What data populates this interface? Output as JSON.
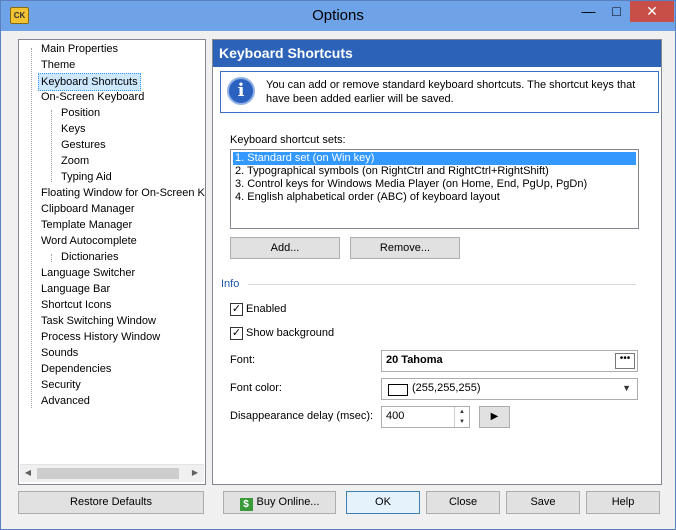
{
  "window": {
    "title": "Options",
    "app_icon_text": "CK"
  },
  "tree": {
    "items": [
      {
        "label": "Main Properties"
      },
      {
        "label": "Theme"
      },
      {
        "label": "Keyboard Shortcuts"
      },
      {
        "label": "On-Screen Keyboard"
      },
      {
        "label": "Position"
      },
      {
        "label": "Keys"
      },
      {
        "label": "Gestures"
      },
      {
        "label": "Zoom"
      },
      {
        "label": "Typing Aid"
      },
      {
        "label": "Floating Window for On-Screen Keyboard"
      },
      {
        "label": "Clipboard Manager"
      },
      {
        "label": "Template Manager"
      },
      {
        "label": "Word Autocomplete"
      },
      {
        "label": "Dictionaries"
      },
      {
        "label": "Language Switcher"
      },
      {
        "label": "Language Bar"
      },
      {
        "label": "Shortcut Icons"
      },
      {
        "label": "Task Switching Window"
      },
      {
        "label": "Process History Window"
      },
      {
        "label": "Sounds"
      },
      {
        "label": "Dependencies"
      },
      {
        "label": "Security"
      },
      {
        "label": "Advanced"
      }
    ]
  },
  "panel": {
    "header": "Keyboard Shortcuts",
    "info_text": "You can add or remove standard keyboard shortcuts. The shortcut keys that have been added earlier will be saved.",
    "sets_label": "Keyboard shortcut sets:",
    "sets": [
      "1. Standard set (on Win key)",
      "2. Typographical symbols (on RightCtrl and RightCtrl+RightShift)",
      "3. Control keys for Windows Media Player (on Home, End, PgUp, PgDn)",
      "4. English alphabetical order (ABC) of keyboard layout"
    ],
    "add_label": "Add...",
    "remove_label": "Remove...",
    "info_group_title": "Info",
    "enabled_label": "Enabled",
    "show_background_label": "Show background",
    "font_label": "Font:",
    "font_value": "20 Tahoma",
    "font_color_label": "Font color:",
    "font_color_value": "(255,255,255)",
    "delay_label": "Disappearance delay (msec):",
    "delay_value": "400"
  },
  "footer": {
    "restore_label": "Restore Defaults",
    "buy_label": "Buy Online...",
    "ok_label": "OK",
    "close_label": "Close",
    "save_label": "Save",
    "help_label": "Help"
  }
}
